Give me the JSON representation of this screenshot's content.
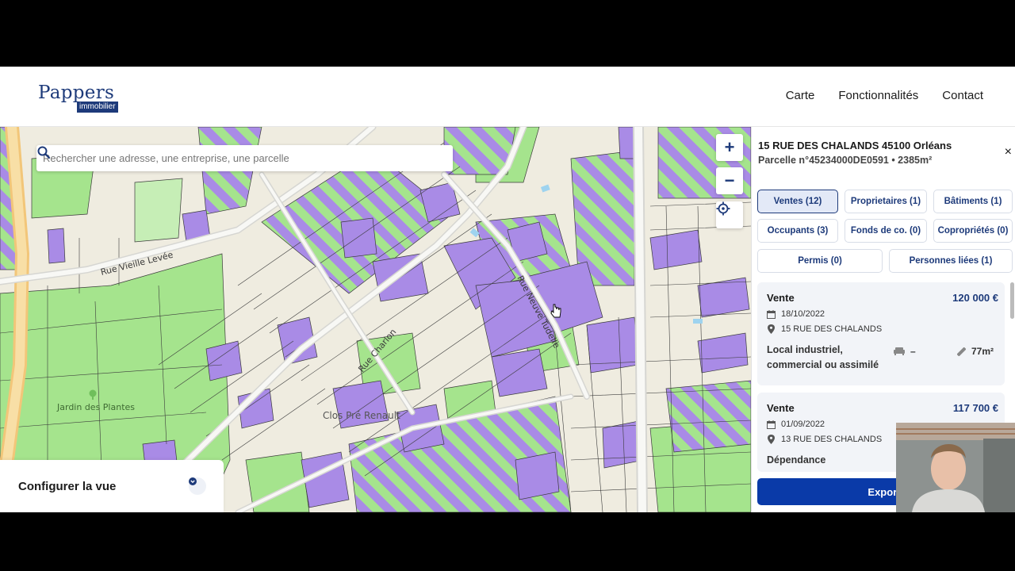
{
  "header": {
    "logo_brand": "Pappers",
    "logo_sub": "immobilier",
    "nav": [
      {
        "label": "Carte"
      },
      {
        "label": "Fonctionnalités"
      },
      {
        "label": "Contact"
      }
    ]
  },
  "map": {
    "search_placeholder": "Rechercher une adresse, une entreprise, une parcelle",
    "zoom_in": "+",
    "zoom_out": "−",
    "streets": [
      "Rue Vieille Levée",
      "Rue Charlon",
      "Rue Neuve Tudelle",
      "Clos Pré Renault",
      "Jardin des Plantes"
    ],
    "config_label": "Configurer la vue",
    "colors": {
      "purple": "#a98be6",
      "green": "#a5e48d",
      "beige": "#efece0",
      "road": "#d6d6d2"
    }
  },
  "panel": {
    "address": "15 RUE DES CHALANDS 45100 Orléans",
    "parcel": "Parcelle n°45234000DE0591 • 2385m²",
    "close": "×",
    "tabs": [
      {
        "label": "Ventes (12)",
        "active": true
      },
      {
        "label": "Proprietaires (1)"
      },
      {
        "label": "Bâtiments (1)"
      },
      {
        "label": "Occupants (3)"
      },
      {
        "label": "Fonds de co. (0)"
      },
      {
        "label": "Copropriétés (0)"
      },
      {
        "label": "Permis (0)"
      },
      {
        "label": "Personnes liées (1)"
      }
    ],
    "sales": [
      {
        "title": "Vente",
        "price": "120 000 €",
        "date": "18/10/2022",
        "address": "15 RUE DES CHALANDS",
        "type": "Local industriel, commercial ou assimilé",
        "rooms": "–",
        "area": "77m²"
      },
      {
        "title": "Vente",
        "price": "117 700 €",
        "date": "01/09/2022",
        "address": "13 RUE DES CHALANDS",
        "type": "Dépendance",
        "rooms": "",
        "area": ""
      }
    ],
    "export_label": "Export"
  },
  "accent": "#1d3a7a"
}
